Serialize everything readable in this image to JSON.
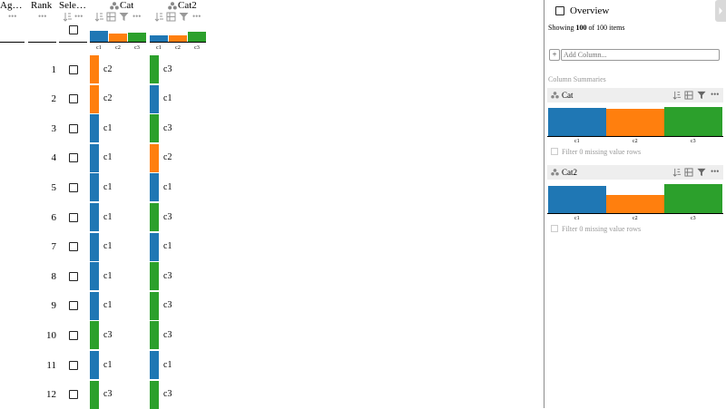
{
  "colors": {
    "c1": "#1f77b4",
    "c2": "#ff7f0e",
    "c3": "#2ca02c",
    "sidebar_border": "#8c8c8c",
    "summary_head_bg": "#eeeeee",
    "muted_text": "#999999"
  },
  "columns": {
    "aggregate": {
      "title": "Ag…",
      "dots": "•••"
    },
    "rank": {
      "title": "Rank",
      "dots": "•••"
    },
    "selection": {
      "title": "Sele…",
      "dots": "•••",
      "sort_icon": "sort-icon"
    },
    "cat": {
      "title": "Cat",
      "dots": "•••",
      "icons": [
        "categorical-icon",
        "sort-icon",
        "group-icon",
        "filter-icon",
        "more-icon"
      ]
    },
    "cat2": {
      "title": "Cat2",
      "dots": "•••",
      "icons": [
        "categorical-icon",
        "sort-icon",
        "group-icon",
        "filter-icon",
        "more-icon"
      ]
    }
  },
  "header_hist_labels": [
    "c1",
    "c2",
    "c3"
  ],
  "rows": [
    {
      "rank": "1",
      "cat": "c2",
      "cat2": "c3"
    },
    {
      "rank": "2",
      "cat": "c2",
      "cat2": "c1"
    },
    {
      "rank": "3",
      "cat": "c1",
      "cat2": "c3"
    },
    {
      "rank": "4",
      "cat": "c1",
      "cat2": "c2"
    },
    {
      "rank": "5",
      "cat": "c1",
      "cat2": "c1"
    },
    {
      "rank": "6",
      "cat": "c1",
      "cat2": "c3"
    },
    {
      "rank": "7",
      "cat": "c1",
      "cat2": "c1"
    },
    {
      "rank": "8",
      "cat": "c1",
      "cat2": "c3"
    },
    {
      "rank": "9",
      "cat": "c1",
      "cat2": "c3"
    },
    {
      "rank": "10",
      "cat": "c3",
      "cat2": "c3"
    },
    {
      "rank": "11",
      "cat": "c1",
      "cat2": "c1"
    },
    {
      "rank": "12",
      "cat": "c3",
      "cat2": "c3"
    }
  ],
  "sidebar": {
    "overview_label": "Overview",
    "showing_prefix": "Showing",
    "showing_count": "100",
    "showing_suffix": "of 100 items",
    "add_column_button": "+",
    "add_column_placeholder": "Add Column...",
    "summaries_title": "Column Summaries",
    "summaries": [
      {
        "name": "Cat",
        "categories": [
          "c1",
          "c2",
          "c3"
        ],
        "values": [
          0.97,
          0.93,
          1.0
        ],
        "filter_text": "Filter 0 missing value rows"
      },
      {
        "name": "Cat2",
        "categories": [
          "c1",
          "c2",
          "c3"
        ],
        "values": [
          0.93,
          0.62,
          1.0
        ],
        "filter_text": "Filter 0 missing value rows"
      }
    ]
  },
  "header_hist": {
    "cat": [
      1.0,
      0.72,
      0.83
    ],
    "cat2": [
      0.6,
      0.55,
      0.95
    ]
  }
}
